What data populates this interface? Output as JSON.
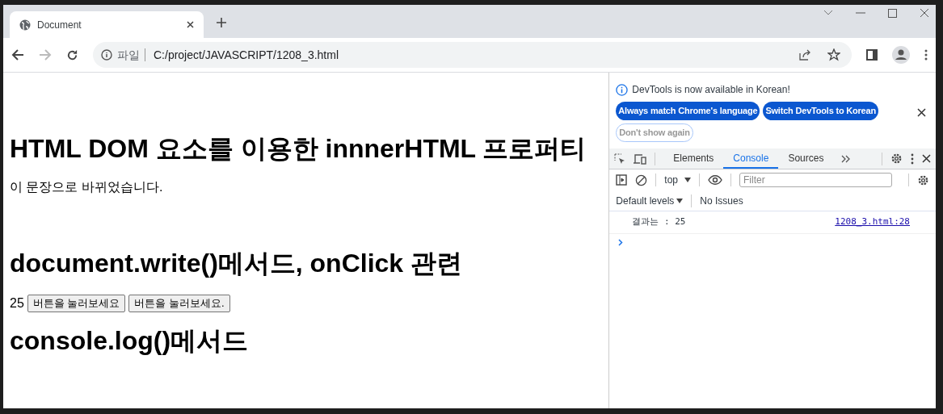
{
  "tabs": [
    {
      "title": "Document",
      "selected": true
    }
  ],
  "address": {
    "scheme_label": "파일",
    "url": "C:/project/JAVASCRIPT/1208_3.html"
  },
  "page": {
    "heading_1": "HTML DOM 요소를 이용한 innnerHTML 프로퍼티",
    "paragraph": "이 문장으로 바뀌었습니다.",
    "heading_2": "document.write()메서드, onClick 관련",
    "output": "25",
    "buttons": [
      "버튼을 눌러보세요",
      "버튼을 눌러보세요."
    ],
    "heading_3": "console.log()메서드"
  },
  "devtools": {
    "notice": "DevTools is now available in Korean!",
    "notice_buttons": [
      {
        "label": "Always match Chrome's language",
        "kind": "primary"
      },
      {
        "label": "Switch DevTools to Korean",
        "kind": "primary"
      },
      {
        "label": "Don't show again",
        "kind": "outline"
      }
    ],
    "tabs": [
      {
        "label": "Elements",
        "selected": false
      },
      {
        "label": "Console",
        "selected": true
      },
      {
        "label": "Sources",
        "selected": false
      }
    ],
    "context": "top",
    "filter_placeholder": "Filter",
    "levels": "Default levels",
    "issues": "No Issues",
    "messages": [
      {
        "text": "결과는 : 25",
        "source": "1208_3.html:28"
      }
    ]
  }
}
